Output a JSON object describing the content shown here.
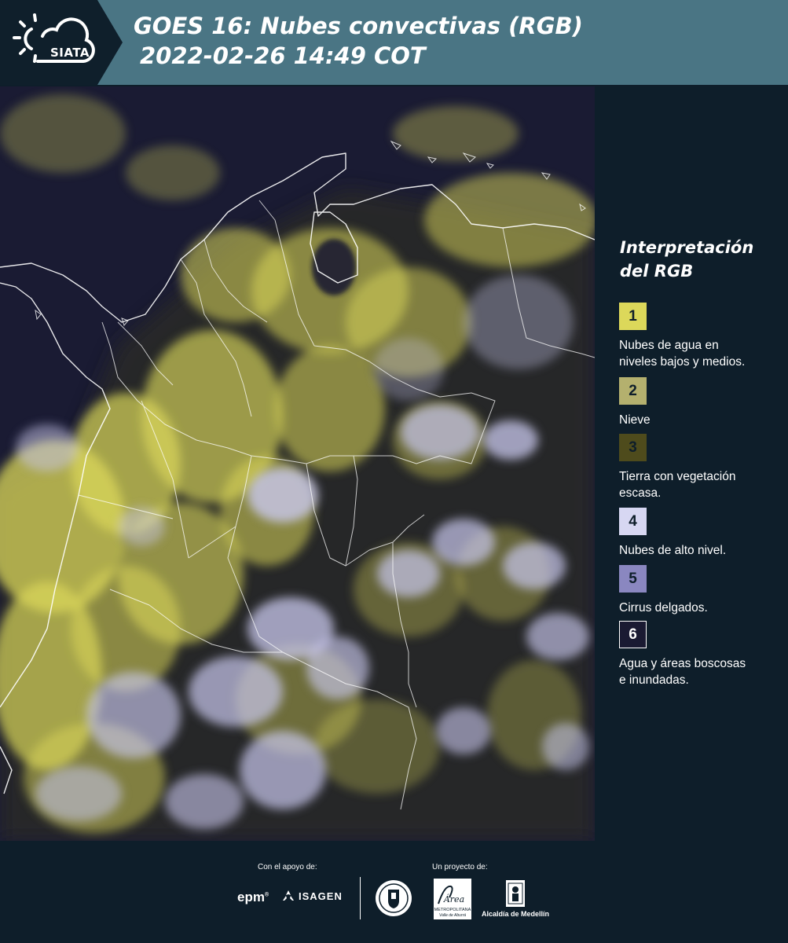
{
  "header": {
    "logo_text": "SIATA",
    "title_line1": "GOES 16: Nubes convectivas (RGB)",
    "title_line2": "2022-02-26 14:49 COT"
  },
  "legend": {
    "title_line1": "Interpretación",
    "title_line2": "del RGB",
    "items": [
      {
        "number": "1",
        "label_line1": "Nubes de agua en",
        "label_line2": "niveles bajos y medios.",
        "color": "#dcd85a"
      },
      {
        "number": "2",
        "label_line1": "Nieve",
        "label_line2": "",
        "color": "#b4b06e"
      },
      {
        "number": "3",
        "label_line1": "Tierra con vegetación",
        "label_line2": "escasa.",
        "color": "#4e4b1c"
      },
      {
        "number": "4",
        "label_line1": "Nubes de alto nivel.",
        "label_line2": "",
        "color": "#d7d7f2"
      },
      {
        "number": "5",
        "label_line1": "Cirrus delgados.",
        "label_line2": "",
        "color": "#8a87c0"
      },
      {
        "number": "6",
        "label_line1": "Agua y áreas boscosas",
        "label_line2": "e inundadas.",
        "color": "#1a1a32"
      }
    ]
  },
  "footer": {
    "support_label": "Con el apoyo de:",
    "project_label": "Un proyecto de:",
    "epm_text": "epm",
    "isagen_text": "ISAGEN",
    "area_text": "Área",
    "area_subtext": "METROPOLITANA",
    "area_subtext2": "Valle de Aburrá",
    "alcaldia_text": "Alcaldía de Medellín"
  },
  "colors": {
    "header_band": "#4a7584",
    "header_dark": "#0f1f2b",
    "panel": "#0e1e2a",
    "map_background": "#1a1b33",
    "cloud_yellow": "#dcd85a",
    "cloud_lavender": "#c9c8ee"
  }
}
